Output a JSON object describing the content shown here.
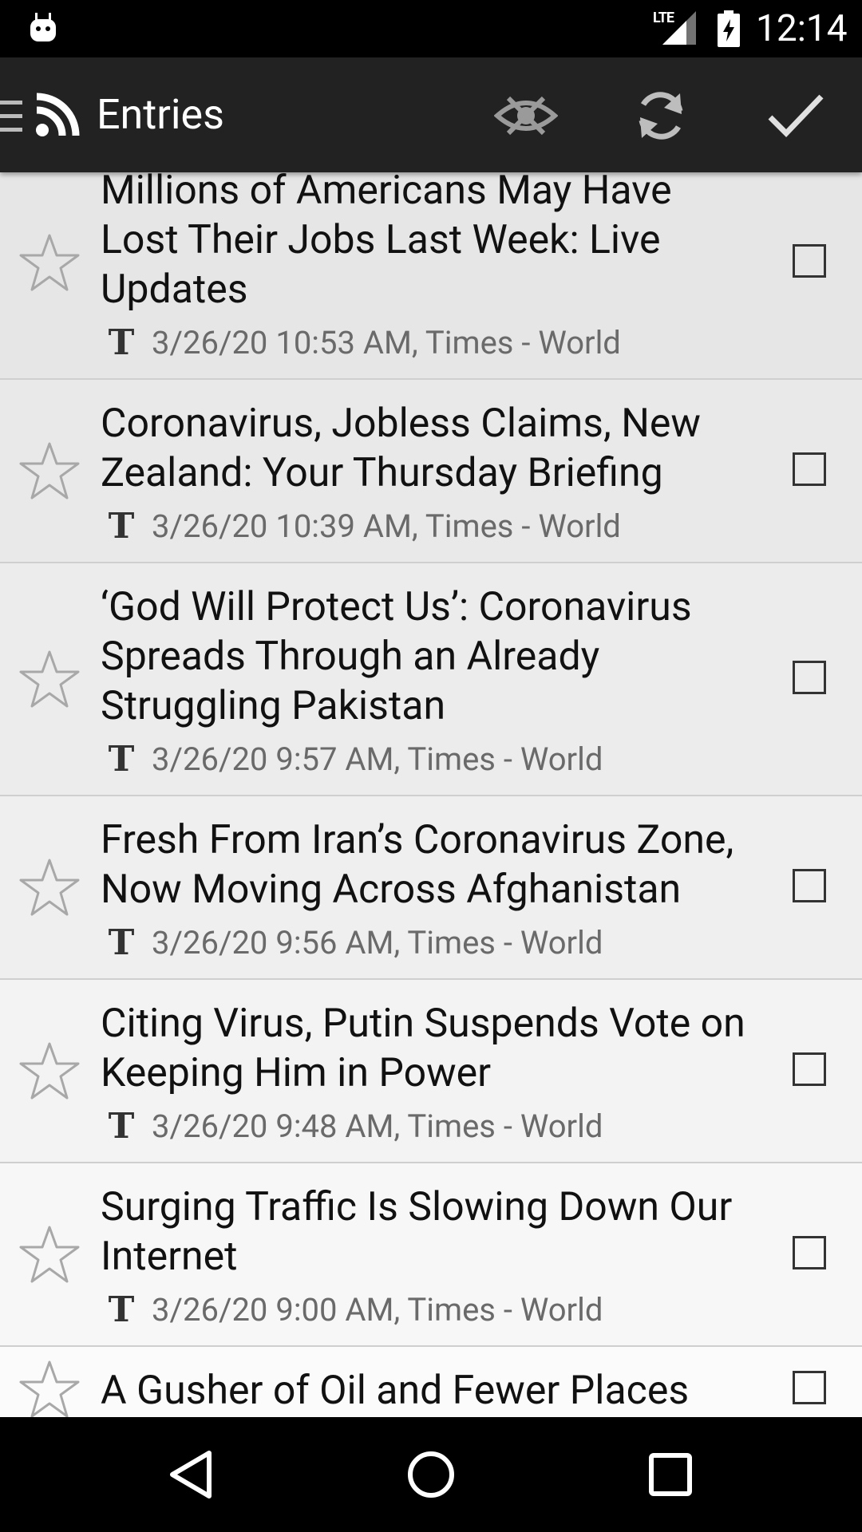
{
  "status_bar": {
    "network": "LTE",
    "time": "12:14"
  },
  "action_bar": {
    "title": "Entries",
    "icons": {
      "menu": "hamburger-icon",
      "feed": "rss-icon",
      "hide": "eye-off-icon",
      "refresh": "refresh-icon",
      "mark_all_read": "check-icon"
    }
  },
  "entries": [
    {
      "title": "Millions of Americans May Have Lost Their Jobs Last Week: Live Updates",
      "meta": "3/26/20 10:53 AM, Times - World",
      "starred": false,
      "checked": false
    },
    {
      "title": "Coronavirus, Jobless Claims, New Zealand: Your Thursday Briefing",
      "meta": "3/26/20 10:39 AM, Times - World",
      "starred": false,
      "checked": false
    },
    {
      "title": "‘God Will Protect Us’: Coronavirus Spreads Through an Already Struggling Pakistan",
      "meta": "3/26/20 9:57 AM, Times - World",
      "starred": false,
      "checked": false
    },
    {
      "title": "Fresh From Iran’s Coronavirus Zone, Now Moving Across Afghanistan",
      "meta": "3/26/20 9:56 AM, Times - World",
      "starred": false,
      "checked": false
    },
    {
      "title": "Citing Virus, Putin Suspends Vote on Keeping Him in Power",
      "meta": "3/26/20 9:48 AM, Times - World",
      "starred": false,
      "checked": false
    },
    {
      "title": "Surging Traffic Is Slowing Down Our Internet",
      "meta": "3/26/20 9:00 AM, Times - World",
      "starred": false,
      "checked": false
    },
    {
      "title": "A Gusher of Oil and Fewer Places",
      "meta": "",
      "starred": false,
      "checked": false
    }
  ],
  "feed_logo_glyph": "T",
  "nav_bar": {
    "back": "back-icon",
    "home": "home-icon",
    "recents": "recents-icon"
  },
  "colors": {
    "status_bar": "#000000",
    "action_bar": "#222222",
    "list_background": "#ebebeb",
    "headline": "#111111",
    "meta": "#6a6a6a"
  }
}
